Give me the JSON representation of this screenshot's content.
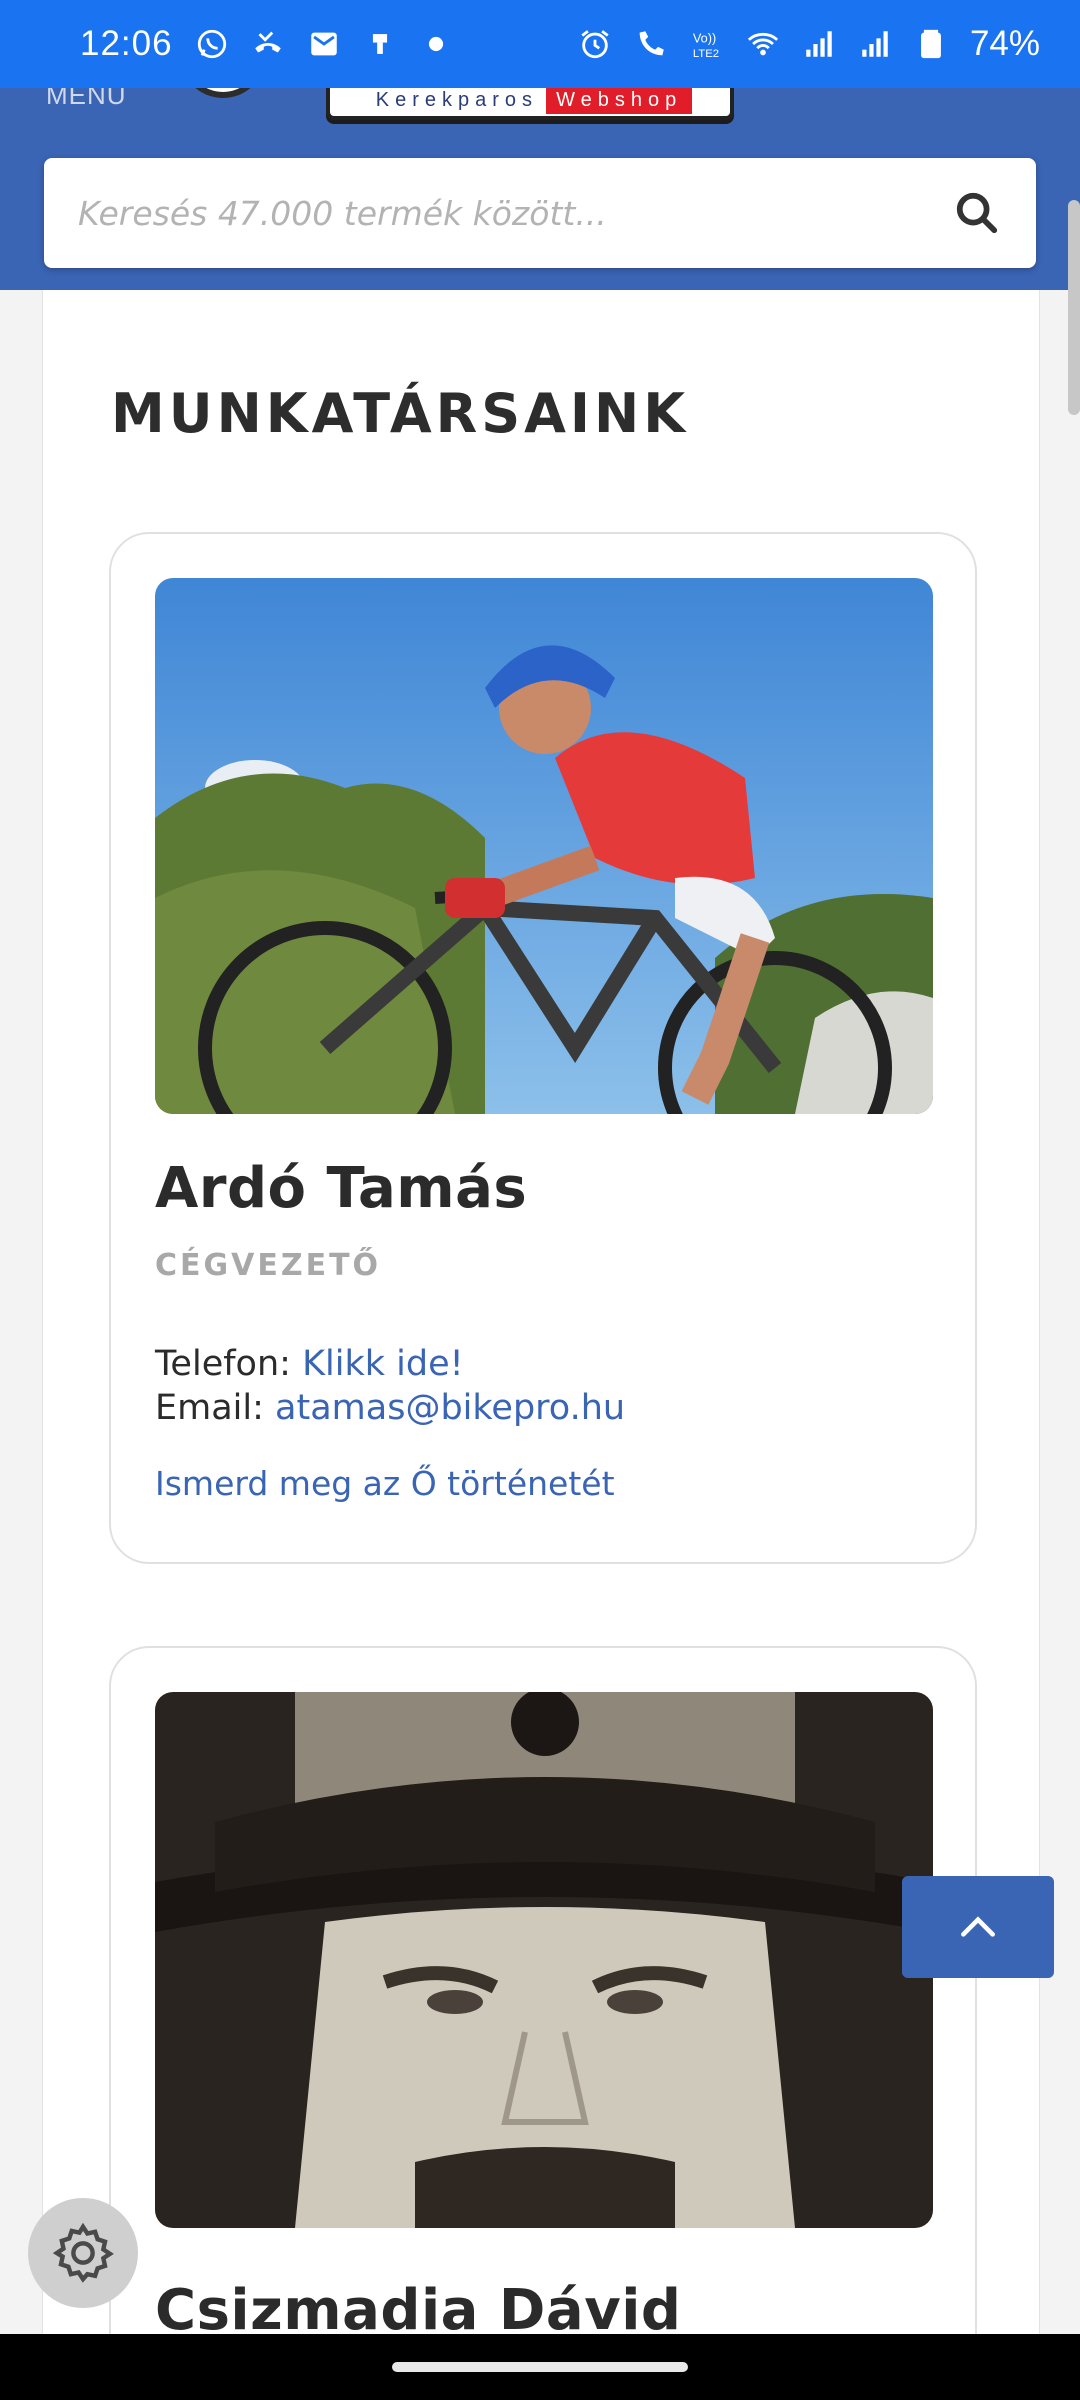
{
  "status_bar": {
    "time": "12:06",
    "battery_percent": "74%",
    "icons_left": [
      "whatsapp-icon",
      "missed-call-icon",
      "mail-icon",
      "usb-icon",
      "dot-icon"
    ],
    "icons_right": [
      "alarm-icon",
      "wifi-calling-icon",
      "volte-icon",
      "wifi-icon",
      "signal-icon",
      "signal-icon",
      "battery-icon"
    ]
  },
  "header": {
    "menu_label": "MENÜ",
    "logo_text_a": "Kerekparos",
    "logo_text_b": "Webshop",
    "search_placeholder": "Keresés 47.000 termék között...",
    "brand_color": "#3a64b4"
  },
  "page": {
    "section_title": "MUNKATÁRSAINK"
  },
  "staff": [
    {
      "name": "Ardó Tamás",
      "role": "CÉGVEZETŐ",
      "phone_label": "Telefon:",
      "phone_link": "Klikk ide!",
      "email_label": "Email:",
      "email": "atamas@bikepro.hu",
      "story_link": "Ismerd meg az Ő történetét"
    },
    {
      "name": "Csizmadia Dávid"
    }
  ]
}
